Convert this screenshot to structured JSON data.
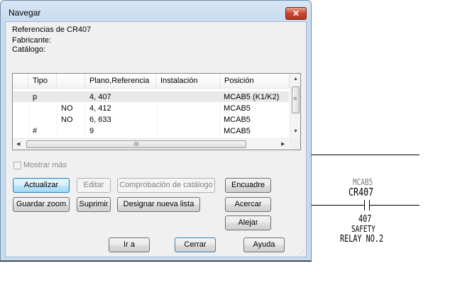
{
  "dialog": {
    "title": "Navegar",
    "close_glyph": "✕",
    "info": {
      "references": "Referencias de CR407",
      "manufacturer_label": "Fabricante:",
      "catalog_label": "Catálogo:"
    },
    "table": {
      "columns": [
        "Tipo",
        "",
        "Plano,Referencia",
        "Instalación",
        "Posición"
      ],
      "rows": [
        {
          "tipo": "p",
          "extra": "",
          "ref": "4, 407",
          "inst": "",
          "pos": "MCAB5 (K1/K2)",
          "selected": true
        },
        {
          "tipo": "",
          "extra": "NO",
          "ref": "4, 412",
          "inst": "",
          "pos": "MCAB5",
          "selected": false
        },
        {
          "tipo": "",
          "extra": "NO",
          "ref": "6, 633",
          "inst": "",
          "pos": "MCAB5",
          "selected": false
        },
        {
          "tipo": "#",
          "extra": "",
          "ref": "9",
          "inst": "",
          "pos": "MCAB5",
          "selected": false
        }
      ],
      "scroll_up_icon": "▲",
      "scroll_down_icon": "▼",
      "scroll_left_icon": "◀",
      "scroll_right_icon": "▶",
      "vthumb_grip": "≡",
      "hthumb_grip": "III"
    },
    "show_more_label": "Mostrar más",
    "buttons": {
      "actualizar": "Actualizar",
      "editar": "Editar",
      "comprobacion": "Comprobación de catálogo",
      "encuadre": "Encuadre",
      "guardar_zoom": "Guardar zoom",
      "suprimir": "Suprimir",
      "designar": "Designar nueva lista",
      "acercar": "Acercar",
      "alejar": "Alejar",
      "ir_a": "Ir a",
      "cerrar": "Cerrar",
      "ayuda": "Ayuda"
    }
  },
  "drawing": {
    "location": "MCAB5",
    "device": "CR407",
    "ref_number": "407",
    "desc_line1": "SAFETY",
    "desc_line2": "RELAY NO.2"
  }
}
